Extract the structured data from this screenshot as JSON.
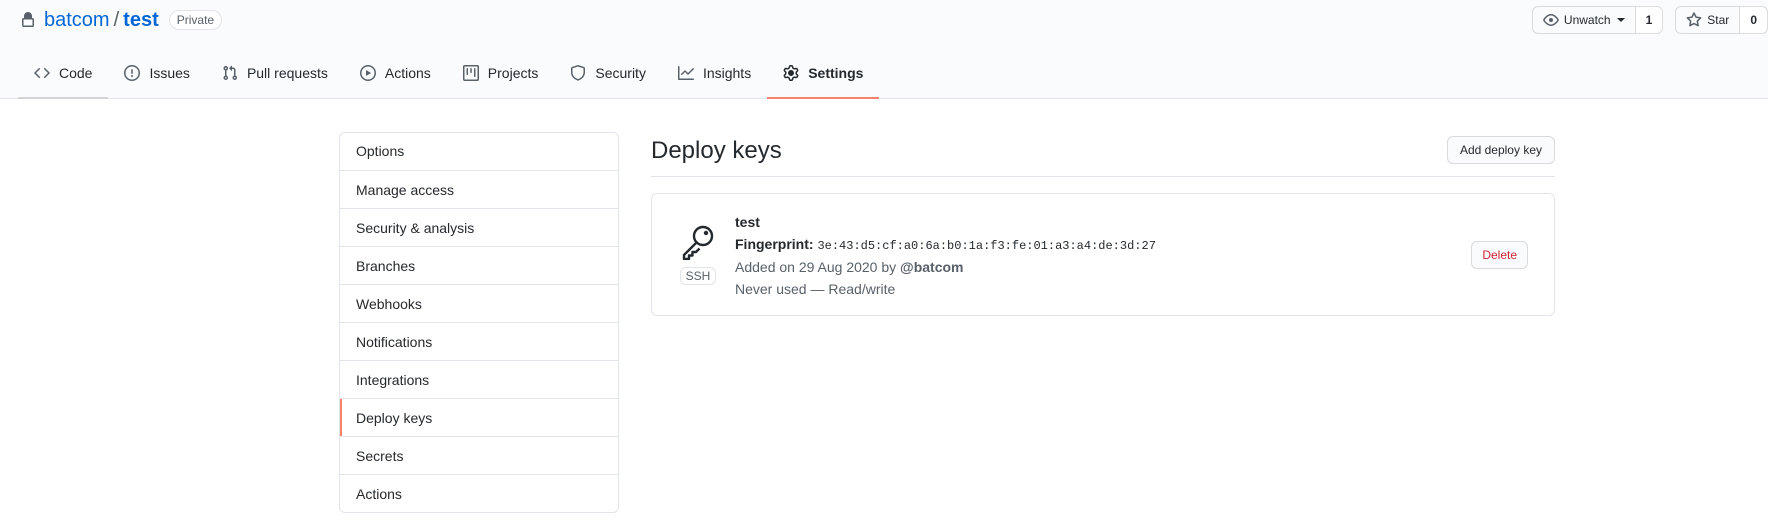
{
  "repo": {
    "owner": "batcom",
    "separator": "/",
    "name": "test",
    "visibility": "Private"
  },
  "header_actions": {
    "watch_label": "Unwatch",
    "watch_count": "1",
    "star_label": "Star",
    "star_count": "0"
  },
  "tabs": [
    {
      "label": "Code",
      "icon": "code-icon"
    },
    {
      "label": "Issues",
      "icon": "issue-icon"
    },
    {
      "label": "Pull requests",
      "icon": "pull-request-icon"
    },
    {
      "label": "Actions",
      "icon": "play-icon"
    },
    {
      "label": "Projects",
      "icon": "project-icon"
    },
    {
      "label": "Security",
      "icon": "shield-icon"
    },
    {
      "label": "Insights",
      "icon": "graph-icon"
    },
    {
      "label": "Settings",
      "icon": "gear-icon",
      "active": true
    }
  ],
  "sidebar": {
    "items": [
      {
        "label": "Options"
      },
      {
        "label": "Manage access"
      },
      {
        "label": "Security & analysis"
      },
      {
        "label": "Branches"
      },
      {
        "label": "Webhooks"
      },
      {
        "label": "Notifications"
      },
      {
        "label": "Integrations"
      },
      {
        "label": "Deploy keys",
        "selected": true
      },
      {
        "label": "Secrets"
      },
      {
        "label": "Actions"
      }
    ]
  },
  "main": {
    "title": "Deploy keys",
    "add_button": "Add deploy key",
    "keys": [
      {
        "title": "test",
        "type": "SSH",
        "fingerprint_label": "Fingerprint:",
        "fingerprint": "3e:43:d5:cf:a0:6a:b0:1a:f3:fe:01:a3:a4:de:3d:27",
        "added_text": "Added on 29 Aug 2020 by",
        "added_by": "@batcom",
        "usage": "Never used — Read/write",
        "delete_label": "Delete"
      }
    ]
  },
  "colors": {
    "link": "#0366d6",
    "active_tab_underline": "#f9826c",
    "danger": "#cb2431",
    "border": "#e1e4e8"
  }
}
